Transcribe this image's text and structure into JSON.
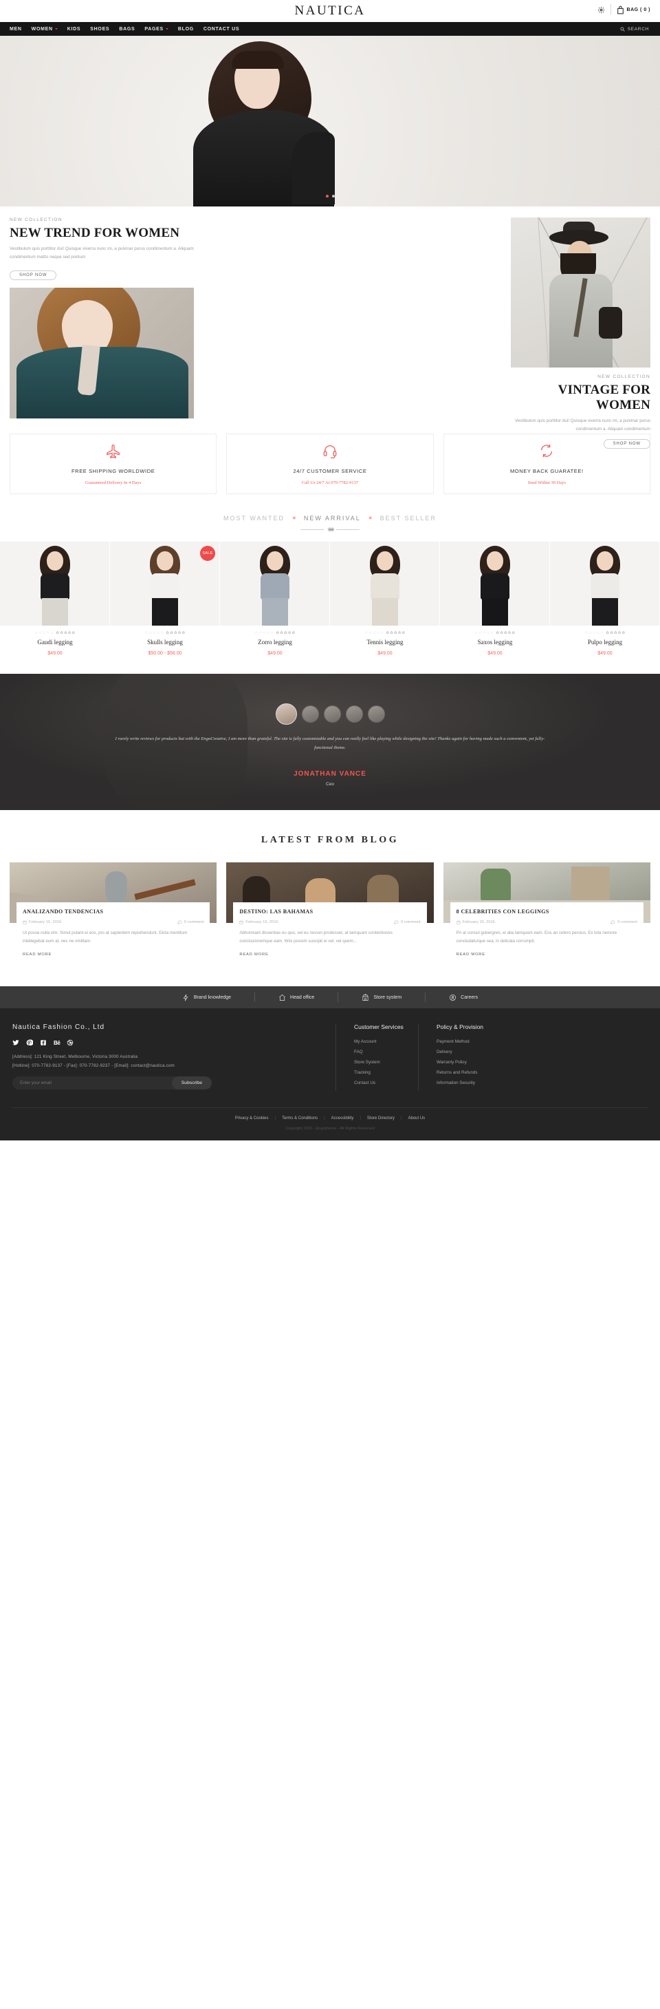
{
  "header": {
    "brand": "NAUTICA",
    "gear_icon": "gear-icon",
    "bag_icon": "shopping-bag-icon",
    "bag_label": "BAG ( 0 )"
  },
  "nav": {
    "items": [
      {
        "label": "MEN",
        "has_caret": false
      },
      {
        "label": "WOMEN",
        "has_caret": true
      },
      {
        "label": "KIDS",
        "has_caret": false
      },
      {
        "label": "SHOES",
        "has_caret": false
      },
      {
        "label": "BAGS",
        "has_caret": false
      },
      {
        "label": "PAGES",
        "has_caret": true
      },
      {
        "label": "BLOG",
        "has_caret": false
      },
      {
        "label": "CONTACT US",
        "has_caret": false
      }
    ],
    "search_label": "SEARCH",
    "search_icon": "search-icon"
  },
  "hero": {
    "slides": 2,
    "active_slide": 1
  },
  "collection_left": {
    "eyebrow": "NEW COLLECTION",
    "title": "NEW TREND FOR WOMEN",
    "desc": "Vestibulum quis porttitor dui! Quisque viverra nunc mi, a pulvinar purus condimentum a. Aliquam condimentum mattis neque sed pretium",
    "cta": "SHOP NOW"
  },
  "collection_right": {
    "eyebrow": "NEW COLLECTION",
    "title": "VINTAGE FOR WOMEN",
    "desc": "Vestibulum quis porttitor dui! Quisque viverra nunc mi, a pulvinar purus condimentum a. Aliquam condimentum",
    "cta": "SHOP NOW"
  },
  "services": [
    {
      "icon": "airplane-icon",
      "title": "FREE SHIPPING WORLDWIDE",
      "sub": "Guaranteed Delivery In 4 Days"
    },
    {
      "icon": "headphones-icon",
      "title": "24/7 CUSTOMER SERVICE",
      "sub": "Call Us 24/7 At 070-7782-9137"
    },
    {
      "icon": "refresh-icon",
      "title": "MONEY BACK GUARATEE!",
      "sub": "Send Within 30 Days"
    }
  ],
  "product_tabs": {
    "tabs": [
      {
        "label": "MOST WANTED",
        "active": false
      },
      {
        "label": "NEW ARRIVAL",
        "active": true
      },
      {
        "label": "BEST SELLER",
        "active": false
      }
    ],
    "separator": "✳"
  },
  "products": [
    {
      "name": "Gaudi legging",
      "price": "$49.00",
      "rating": 0,
      "badge": "",
      "top": "#1d1d1f",
      "bottom": "#d9d6d0"
    },
    {
      "name": "Skulls legging",
      "price": "$50.00 - $56.00",
      "rating": 0,
      "badge": "SALE",
      "top": "#f2f1ef",
      "bottom": "#1b1b1d"
    },
    {
      "name": "Zorro legging",
      "price": "$49.00",
      "rating": 0,
      "badge": "",
      "top": "#9fa9b5",
      "bottom": "#aab2bb"
    },
    {
      "name": "Tennis legging",
      "price": "$49.00",
      "rating": 0,
      "badge": "",
      "top": "#e8e3da",
      "bottom": "#ded8cf"
    },
    {
      "name": "Saxos legging",
      "price": "$49.00",
      "rating": 0,
      "badge": "",
      "top": "#1a1a1c",
      "bottom": "#17171a"
    },
    {
      "name": "Pulpo legging",
      "price": "$49.00",
      "rating": 0,
      "badge": "",
      "top": "#ecebe8",
      "bottom": "#1c1c1e"
    }
  ],
  "testimonial": {
    "quote": "I rarely write reviews for products but with the EngoCreative, I am more than grateful. The site is fully customizable and you can really feel like playing while designing the site! Thanks again for having made such a convenient, yet fully-functional theme.",
    "name": "JONATHAN VANCE",
    "role": "Ceo",
    "avatar_count": 5,
    "active_avatar": 0
  },
  "blog": {
    "title": "LATEST FROM BLOG",
    "posts": [
      {
        "title": "ANALIZANDO TENDENCIAS",
        "date": "February 15, 2016",
        "comments": "0 comment",
        "excerpt": "Ut posse nulla vim. Simul putant ei eos, pro at sapientem reprehendunt. Dicta mentitum intellegebat eum at, nec ne omittam.",
        "read_more": "READ MORE"
      },
      {
        "title": "DESTINO: LAS BAHAMAS",
        "date": "February 15, 2016",
        "comments": "0 comment",
        "excerpt": "Abhorreant dissentias eu quo, vel eu novum prodesset, at tamquam contentiones conclusionemque eam. Wisi possim suscipit ei vel, vel quem...",
        "read_more": "READ MORE"
      },
      {
        "title": "8 CELEBRITIES CON LEGGINGS",
        "date": "February 15, 2016",
        "comments": "0 comment",
        "excerpt": "Pri at consul gubergren, ei alia tamquam eam. Eos an cetero persius. Ex tota nemore concludaturque sea, in delicata corrumpit.",
        "read_more": "READ MORE"
      }
    ]
  },
  "feature_strip": [
    {
      "icon": "bolt-icon",
      "label": "Brand knowledge"
    },
    {
      "icon": "home-icon",
      "label": "Head office"
    },
    {
      "icon": "store-icon",
      "label": "Store system"
    },
    {
      "icon": "person-badge-icon",
      "label": "Careers"
    }
  ],
  "footer": {
    "brand": "Nautica  Fashion  Co.,  Ltd",
    "socials": [
      "twitter-icon",
      "pinterest-icon",
      "facebook-icon",
      "behance-icon",
      "dribbble-icon"
    ],
    "address": "[Address]: 121 King Street, Melbourne, Victoria 3000 Australia",
    "contact": "[Hotline]: 070-7782-9137 - [Fax]: 070-7782-9237 - [Email]: contact@nautica.com",
    "newsletter_placeholder": "Enter your email",
    "subscribe_label": "Subscribe",
    "columns": [
      {
        "heading": "Customer Services",
        "items": [
          "My Account",
          "FAQ",
          "Store System",
          "Tracking",
          "Contact Us"
        ]
      },
      {
        "heading": "Policy & Provision",
        "items": [
          "Payment Method",
          "Delivery",
          "Warranty Policy",
          "Returns and Refunds",
          "Information Security"
        ]
      }
    ],
    "bottom_links": [
      "Privacy & Cookies",
      "Terms & Conditions",
      "Accessibility",
      "Store Directory",
      "About Us"
    ],
    "copyright": "Copyright 2015 - Engotheme - All Rights Reserved"
  },
  "colors": {
    "accent": "#ef5a5a",
    "nav_bg": "#161616",
    "footer_bg": "#242424"
  }
}
